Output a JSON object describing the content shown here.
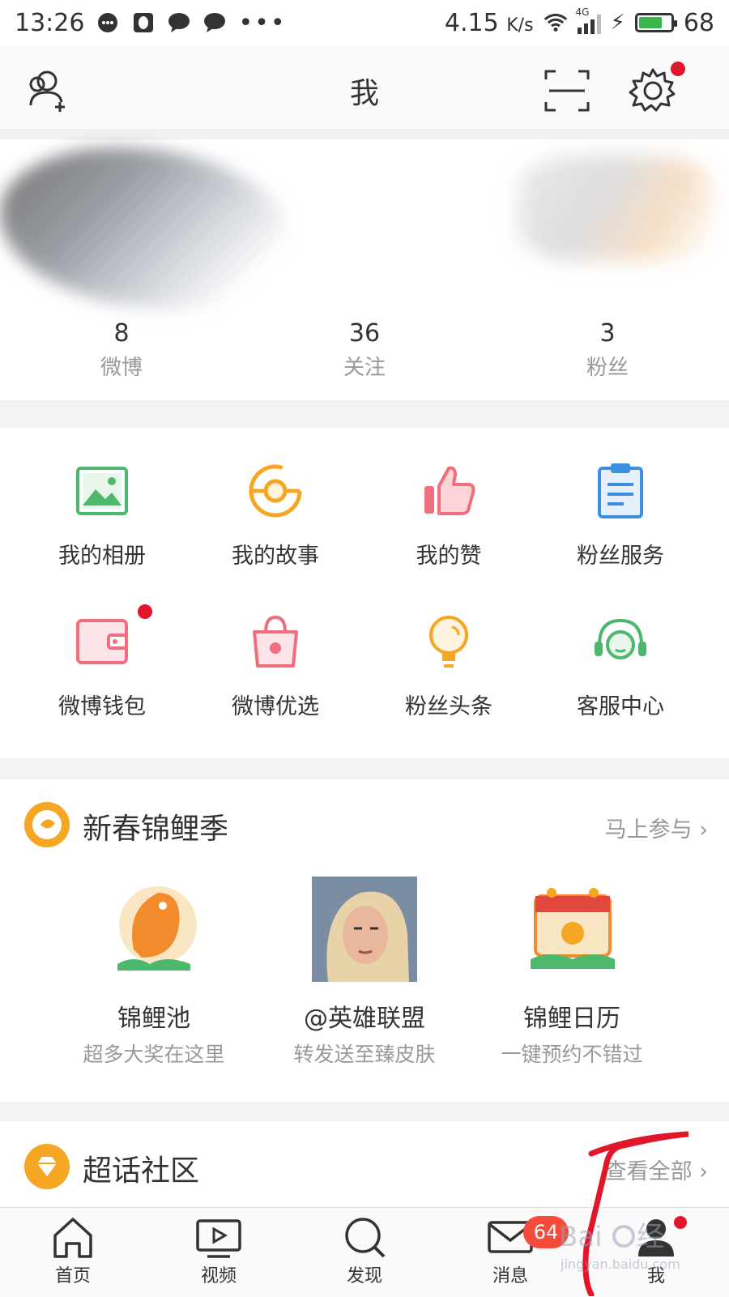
{
  "status_bar": {
    "time": "13:26",
    "speed": "4.15",
    "speed_unit": "K/s",
    "network": "4G",
    "battery": "68"
  },
  "header": {
    "title": "我"
  },
  "profile": {
    "stats": [
      {
        "value": "8",
        "label": "微博"
      },
      {
        "value": "36",
        "label": "关注"
      },
      {
        "value": "3",
        "label": "粉丝"
      }
    ]
  },
  "grid": [
    {
      "label": "我的相册",
      "icon": "album-icon"
    },
    {
      "label": "我的故事",
      "icon": "story-icon"
    },
    {
      "label": "我的赞",
      "icon": "thumbs-up-icon"
    },
    {
      "label": "粉丝服务",
      "icon": "clipboard-icon"
    },
    {
      "label": "微博钱包",
      "icon": "wallet-icon"
    },
    {
      "label": "微博优选",
      "icon": "shopping-bag-icon"
    },
    {
      "label": "粉丝头条",
      "icon": "lightbulb-icon"
    },
    {
      "label": "客服中心",
      "icon": "headset-icon"
    }
  ],
  "promo_card": {
    "title": "新春锦鲤季",
    "more": "马上参与",
    "items": [
      {
        "name": "锦鲤池",
        "desc": "超多大奖在这里"
      },
      {
        "name": "@英雄联盟",
        "desc": "转发送至臻皮肤"
      },
      {
        "name": "锦鲤日历",
        "desc": "一键预约不错过"
      }
    ]
  },
  "super_topic": {
    "title": "超话社区",
    "more": "查看全部"
  },
  "tabbar": {
    "tabs": [
      {
        "label": "首页"
      },
      {
        "label": "视频"
      },
      {
        "label": "发现"
      },
      {
        "label": "消息"
      },
      {
        "label": "我"
      }
    ],
    "message_badge": "64"
  },
  "colors": {
    "accent_orange": "#f5a623",
    "red_dot": "#e2162a",
    "green": "#4cb86b",
    "pink": "#f06e7e",
    "blue": "#3f8fe0"
  }
}
